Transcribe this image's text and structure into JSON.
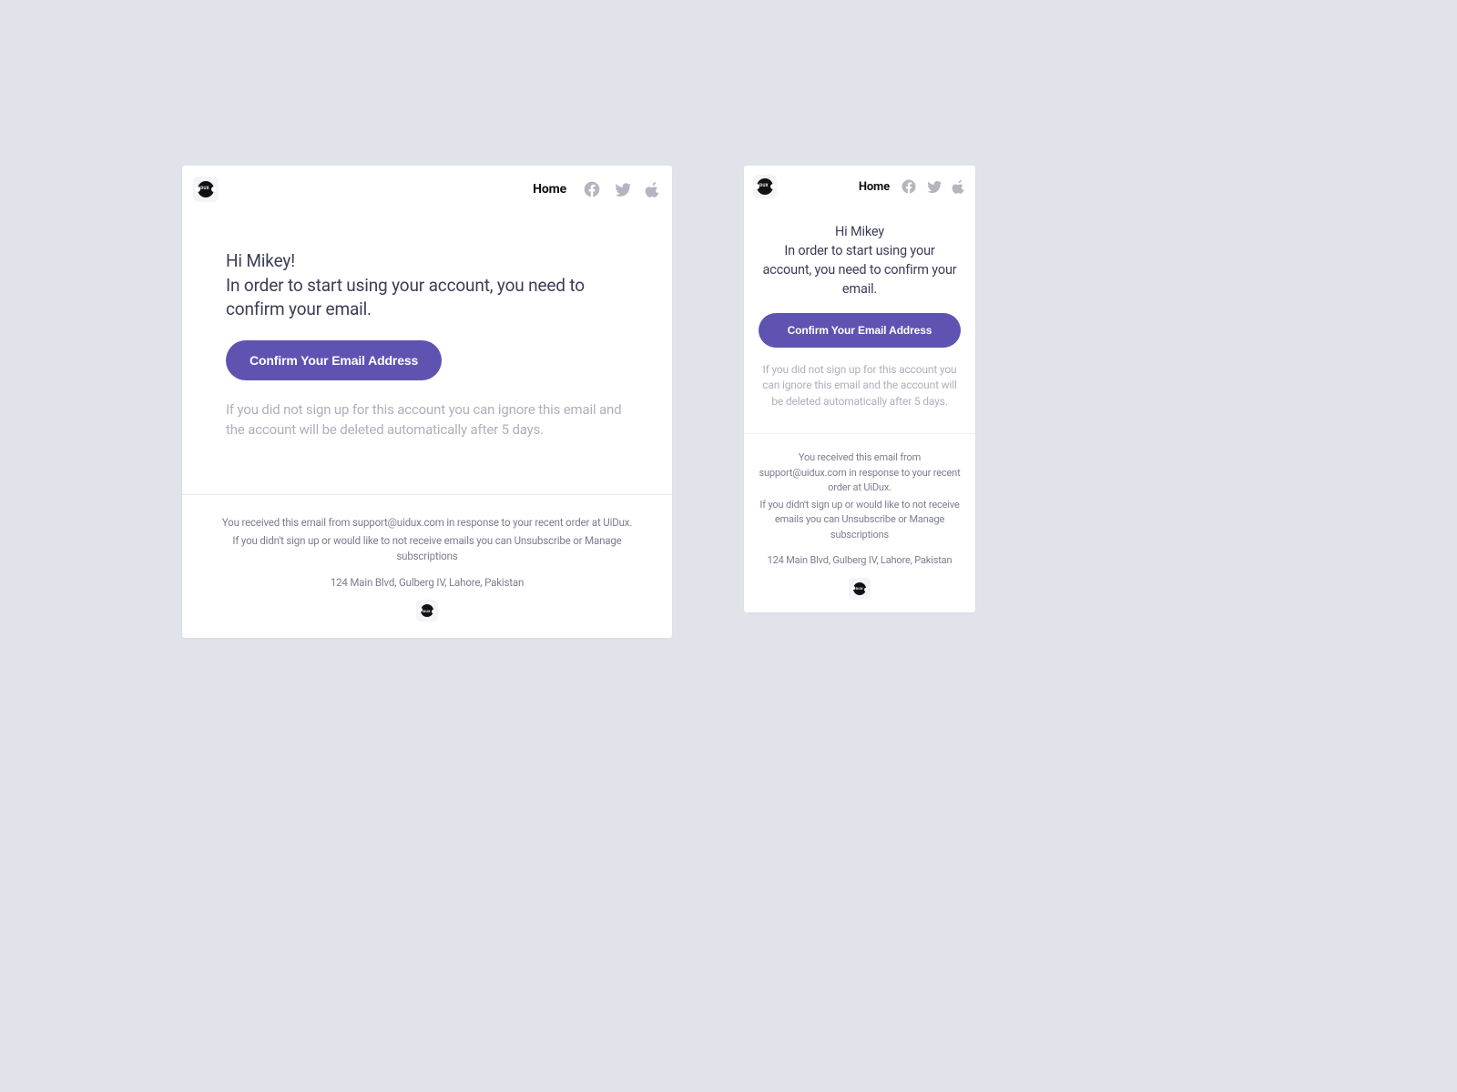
{
  "logo_text": "iDUX",
  "nav": {
    "home": "Home"
  },
  "desktop": {
    "greeting": "Hi Mikey!\nIn order to start using your account, you need to confirm your email.",
    "cta": "Confirm Your Email Address",
    "disclaimer": "If you did not sign up for this account you can ignore this email and the account will be deleted automatically after 5 days."
  },
  "mobile": {
    "greeting": "Hi Mikey\nIn order to start using your account, you need to confirm your email.",
    "cta": "Confirm Your Email Address",
    "disclaimer": "If you did not sign up for this account you can ignore this email and the account will be deleted automatically after 5 days."
  },
  "footer": {
    "line1": "You received this email from support@uidux.com in response to your recent order at UiDux.",
    "line2": "If you didn't sign up or would like to not receive emails you can Unsubscribe or Manage subscriptions",
    "address": "124 Main Blvd, Gulberg IV, Lahore, Pakistan"
  }
}
